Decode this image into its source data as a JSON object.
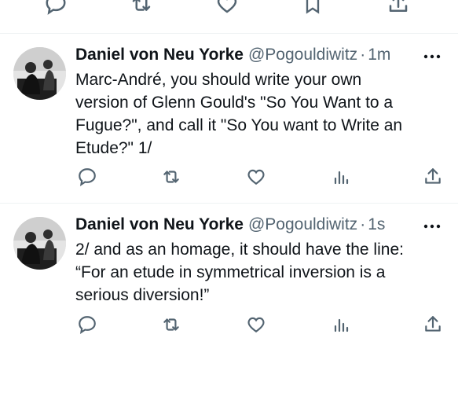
{
  "icons": {
    "reply": "reply-icon",
    "retweet": "retweet-icon",
    "like": "like-icon",
    "bookmark": "bookmark-icon",
    "share": "share-icon",
    "views": "views-icon",
    "more": "more-icon"
  },
  "colors": {
    "text": "#0f1419",
    "muted": "#536471",
    "divider": "#eff3f4"
  },
  "tweets": [
    {
      "name": "Daniel von Neu Yorke",
      "handle": "@Pogouldiwitz",
      "separator": "·",
      "time": "1m",
      "lines": [
        "Marc-André, you should write your own",
        "version of Glenn Gould's \"So You Want to a",
        "Fugue?\", and call it \"So You want to Write an",
        "Etude?\" 1/"
      ]
    },
    {
      "name": "Daniel von Neu Yorke",
      "handle": "@Pogouldiwitz",
      "separator": "·",
      "time": "1s",
      "lines": [
        "2/ and as an homage, it should have the line:",
        "“For an etude in symmetrical inversion is a",
        "serious diversion!”"
      ]
    }
  ]
}
